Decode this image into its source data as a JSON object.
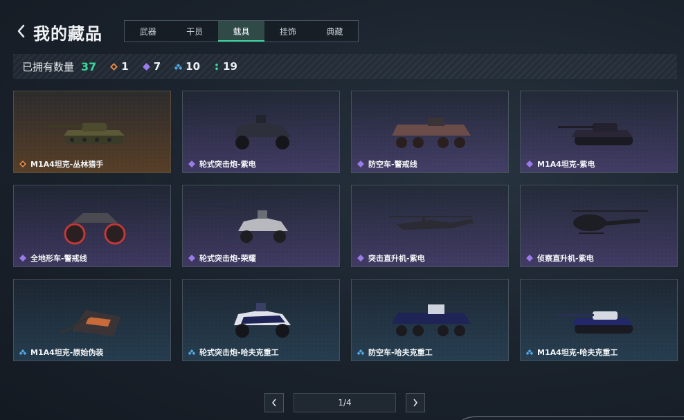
{
  "header": {
    "title": "我的藏品",
    "tabs": [
      {
        "label": "武器",
        "active": false
      },
      {
        "label": "干员",
        "active": false
      },
      {
        "label": "载具",
        "active": true
      },
      {
        "label": "挂饰",
        "active": false
      },
      {
        "label": "典藏",
        "active": false
      }
    ]
  },
  "stats": {
    "label": "已拥有数量",
    "total": "37",
    "orange_count": "1",
    "purple_count": "7",
    "blue_count": "10",
    "green_count": "19"
  },
  "colors": {
    "accent_green": "#35d39c",
    "rarity_orange": "#e0894a",
    "rarity_purple": "#9b7bea",
    "rarity_blue": "#4ea6e0",
    "rarity_green": "#37d99b"
  },
  "items": [
    {
      "name": "M1A4坦克-丛林猎手",
      "rarity": "orange",
      "icon": "tank"
    },
    {
      "name": "轮式突击炮-紫电",
      "rarity": "purple",
      "icon": "armored-car"
    },
    {
      "name": "防空车-警戒线",
      "rarity": "purple",
      "icon": "aa-vehicle"
    },
    {
      "name": "M1A4坦克-紫电",
      "rarity": "purple",
      "icon": "tank"
    },
    {
      "name": "全地形车-警戒线",
      "rarity": "purple",
      "icon": "atv"
    },
    {
      "name": "轮式突击炮-荣耀",
      "rarity": "purple",
      "icon": "armored-car"
    },
    {
      "name": "突击直升机-紫电",
      "rarity": "purple",
      "icon": "attack-helicopter"
    },
    {
      "name": "侦察直升机-紫电",
      "rarity": "purple",
      "icon": "scout-helicopter"
    },
    {
      "name": "M1A4坦克-原始伪装",
      "rarity": "blue",
      "icon": "tank"
    },
    {
      "name": "轮式突击炮-哈夫克重工",
      "rarity": "blue",
      "icon": "armored-car"
    },
    {
      "name": "防空车-哈夫克重工",
      "rarity": "blue",
      "icon": "aa-vehicle"
    },
    {
      "name": "M1A4坦克-哈夫克重工",
      "rarity": "blue",
      "icon": "tank"
    }
  ],
  "pagination": {
    "text": "1/4"
  }
}
